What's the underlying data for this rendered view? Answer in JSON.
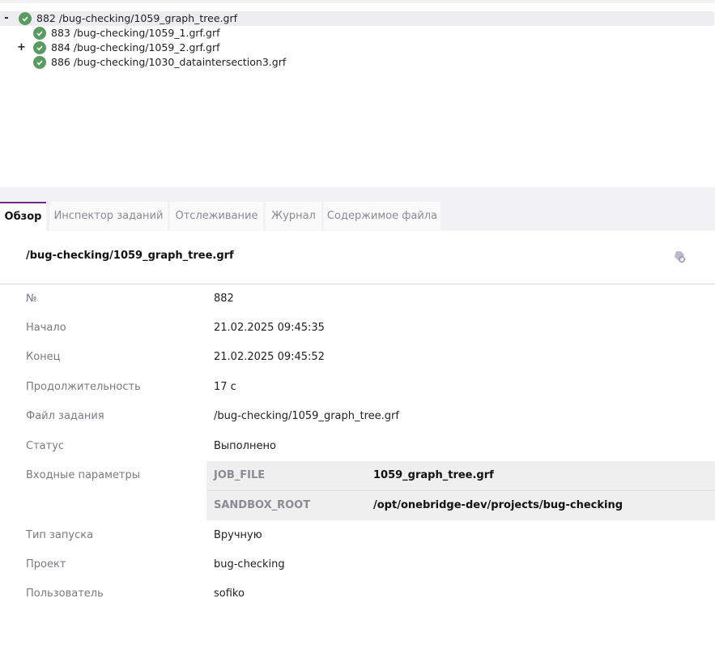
{
  "tree": {
    "items": [
      {
        "toggle": "-",
        "label": "882 /bug-checking/1059_graph_tree.grf"
      },
      {
        "toggle": "",
        "label": "883 /bug-checking/1059_1.grf.grf"
      },
      {
        "toggle": "+",
        "label": "884 /bug-checking/1059_2.grf.grf"
      },
      {
        "toggle": "",
        "label": "886 /bug-checking/1030_dataintersection3.grf"
      }
    ]
  },
  "tabs": [
    "Обзор",
    "Инспектор заданий",
    "Отслеживание",
    "Журнал",
    "Содержимое файла"
  ],
  "header": {
    "title": "/bug-checking/1059_graph_tree.grf",
    "settings_icon": "settings-gear-icon"
  },
  "props": {
    "number": {
      "label": "№",
      "value": "882"
    },
    "start": {
      "label": "Начало",
      "value": "21.02.2025 09:45:35"
    },
    "end": {
      "label": "Конец",
      "value": "21.02.2025 09:45:52"
    },
    "duration": {
      "label": "Продолжительность",
      "value": "17 с"
    },
    "job_file": {
      "label": "Файл задания",
      "value": "/bug-checking/1059_graph_tree.grf"
    },
    "status": {
      "label": "Статус",
      "value": "Выполнено"
    },
    "input_params": {
      "label": "Входные параметры",
      "rows": [
        {
          "key": "JOB_FILE",
          "value": "1059_graph_tree.grf"
        },
        {
          "key": "SANDBOX_ROOT",
          "value": "/opt/onebridge-dev/projects/bug-checking"
        }
      ]
    },
    "launch_type": {
      "label": "Тип запуска",
      "value": "Вручную"
    },
    "project": {
      "label": "Проект",
      "value": "bug-checking"
    },
    "user": {
      "label": "Пользователь",
      "value": "sofiko"
    }
  },
  "colors": {
    "accent": "#6d2a86",
    "success": "#5b9a63"
  }
}
